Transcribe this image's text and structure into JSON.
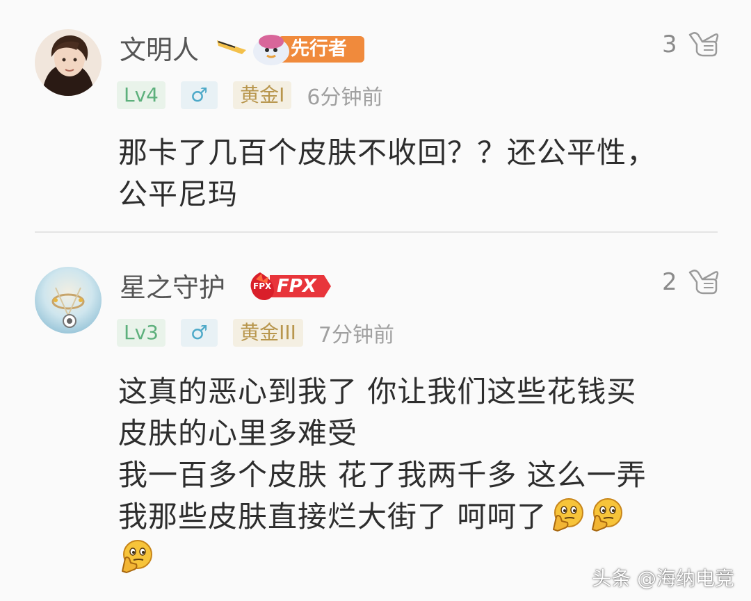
{
  "comments": [
    {
      "username": "文明人",
      "badge_label": "先行者",
      "likes": "3",
      "level": "Lv4",
      "gender": "♂",
      "rank": "黄金I",
      "time": "6分钟前",
      "lines": [
        "那卡了几百个皮肤不收回？？还公平性，",
        "公平尼玛"
      ]
    },
    {
      "username": "星之守护",
      "badge_label": "FPX",
      "badge_small": "FPX",
      "likes": "2",
      "level": "Lv3",
      "gender": "♂",
      "rank": "黄金III",
      "time": "7分钟前",
      "lines": [
        "这真的恶心到我了 你让我们这些花钱买",
        "皮肤的心里多难受",
        "我一百多个皮肤 花了我两千多 这么一弄",
        "我那些皮肤直接烂大街了 呵呵了"
      ]
    }
  ],
  "watermark": "头条 @海纳电竞",
  "icons": {
    "like": "hand-like-icon",
    "emoji": "thinking-face-emoji"
  },
  "colors": {
    "badge_orange": "#f08a3c",
    "badge_red": "#e8353b",
    "level_green": "#5db07c",
    "gender_blue": "#4da9c8",
    "rank_gold": "#b8964d"
  }
}
